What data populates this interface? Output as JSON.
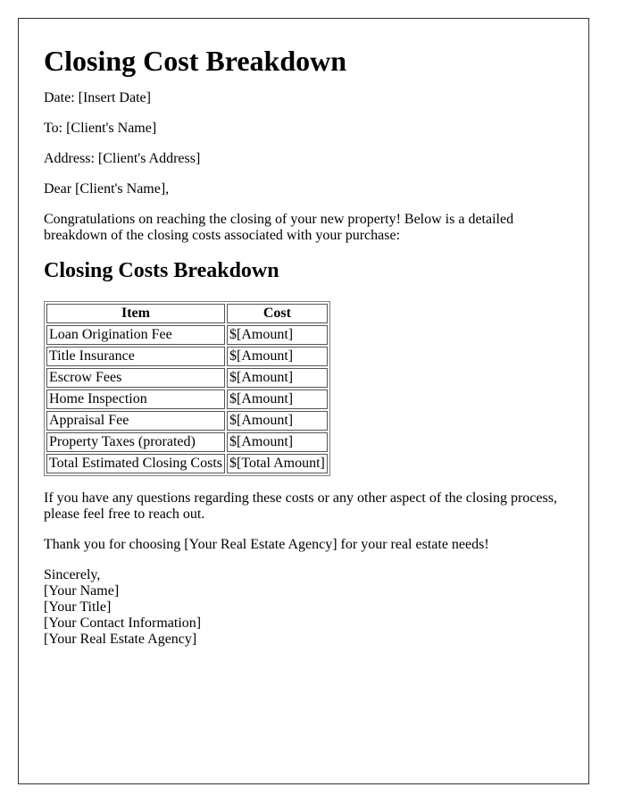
{
  "document": {
    "title": "Closing Cost Breakdown",
    "header_lines": [
      "Date: [Insert Date]",
      "To: [Client's Name]",
      "Address: [Client's Address]"
    ],
    "salutation": "Dear [Client's Name],",
    "intro": "Congratulations on reaching the closing of your new property! Below is a detailed breakdown of the closing costs associated with your purchase:",
    "section_title": "Closing Costs Breakdown",
    "table": {
      "headers": [
        "Item",
        "Cost"
      ],
      "rows": [
        [
          "Loan Origination Fee",
          "$[Amount]"
        ],
        [
          "Title Insurance",
          "$[Amount]"
        ],
        [
          "Escrow Fees",
          "$[Amount]"
        ],
        [
          "Home Inspection",
          "$[Amount]"
        ],
        [
          "Appraisal Fee",
          "$[Amount]"
        ],
        [
          "Property Taxes (prorated)",
          "$[Amount]"
        ],
        [
          "Total Estimated Closing Costs",
          "$[Total Amount]"
        ]
      ]
    },
    "questions": "If you have any questions regarding these costs or any other aspect of the closing process, please feel free to reach out.",
    "thanks": "Thank you for choosing [Your Real Estate Agency] for your real estate needs!",
    "closing": "Sincerely,",
    "signature_lines": [
      "[Your Name]",
      "[Your Title]",
      "[Your Contact Information]",
      "[Your Real Estate Agency]"
    ]
  }
}
